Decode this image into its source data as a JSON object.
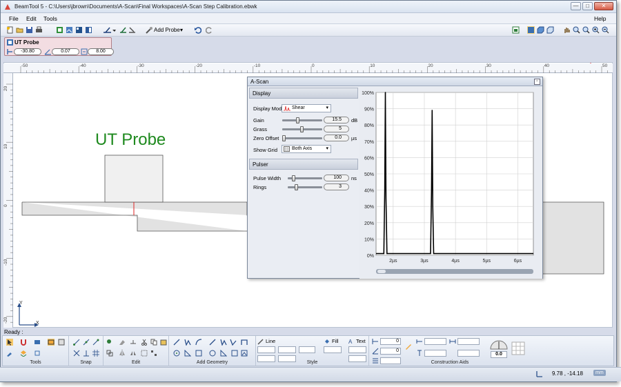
{
  "window": {
    "title": "BeamTool 5 - C:\\Users\\jbrown\\Documents\\A-Scan\\Final Workspaces\\A-Scan Step Calibration.ebwk",
    "minimize": "—",
    "maximize": "□",
    "close": "✕"
  },
  "menu": {
    "file": "File",
    "edit": "Edit",
    "tools": "Tools",
    "help": "Help"
  },
  "toolbar": {
    "add_probe": "Add Probe"
  },
  "probe_panel": {
    "title": "UT Probe",
    "x_value": "-30.80",
    "angle_value": "0.07",
    "size_value": "8.00"
  },
  "ruler": {
    "h_labels": [
      "-50",
      "-40",
      "-30",
      "-20",
      "-10",
      "0",
      "10",
      "20",
      "30",
      "40",
      "50"
    ],
    "v_labels": [
      "20",
      "10",
      "0",
      "-10",
      "-20"
    ],
    "axis_x": "X",
    "axis_y": "Y"
  },
  "canvas": {
    "probe_label": "UT Probe",
    "probe_label_color": "#1f8a1f"
  },
  "status": {
    "ready": "Ready :",
    "coords": "9.78 , -14.18",
    "units": "mm"
  },
  "ribbon": {
    "groups": [
      "Tools",
      "Snap",
      "Edit",
      "Add Geometry",
      "Style",
      "Construction Aids"
    ],
    "line_label": "Line",
    "fill_label": "Fill",
    "text_label": "Text",
    "field1": "0",
    "field2": "0",
    "angle_readout": "0.0"
  },
  "ascan": {
    "title": "A-Scan",
    "display_section": "Display",
    "display_mode_label": "Display Mode",
    "display_mode_value": "Shear",
    "gain_label": "Gain",
    "gain_value": "15.5",
    "gain_unit": "dB",
    "grass_label": "Grass",
    "grass_value": "5",
    "zero_offset_label": "Zero Offset",
    "zero_offset_value": "0.0",
    "zero_offset_unit": "µs",
    "show_grid_label": "Show Grid",
    "show_grid_value": "Both Axis",
    "pulser_section": "Pulser",
    "pulse_width_label": "Pulse Width",
    "pulse_width_value": "100",
    "pulse_width_unit": "ns",
    "rings_label": "Rings",
    "rings_value": "3"
  },
  "chart_data": {
    "type": "line",
    "y_tick_labels": [
      "100%",
      "90%",
      "80%",
      "70%",
      "60%",
      "50%",
      "40%",
      "30%",
      "20%",
      "10%",
      "0%"
    ],
    "x_tick_labels": [
      "2µs",
      "3µs",
      "4µs",
      "5µs",
      "6µs"
    ],
    "x_ticks": [
      2,
      3,
      4,
      5,
      6
    ],
    "xlim": [
      1.45,
      6.5
    ],
    "ylim": [
      0,
      100
    ],
    "grid": true,
    "series": [
      {
        "x": [
          1.45,
          1.7,
          1.73,
          1.75,
          1.77,
          1.8,
          2.9,
          3.2,
          3.23,
          3.25,
          3.27,
          3.3,
          6.5
        ],
        "values": [
          1,
          1,
          40,
          100,
          35,
          1,
          1,
          1,
          40,
          89,
          30,
          1,
          1
        ]
      }
    ]
  }
}
